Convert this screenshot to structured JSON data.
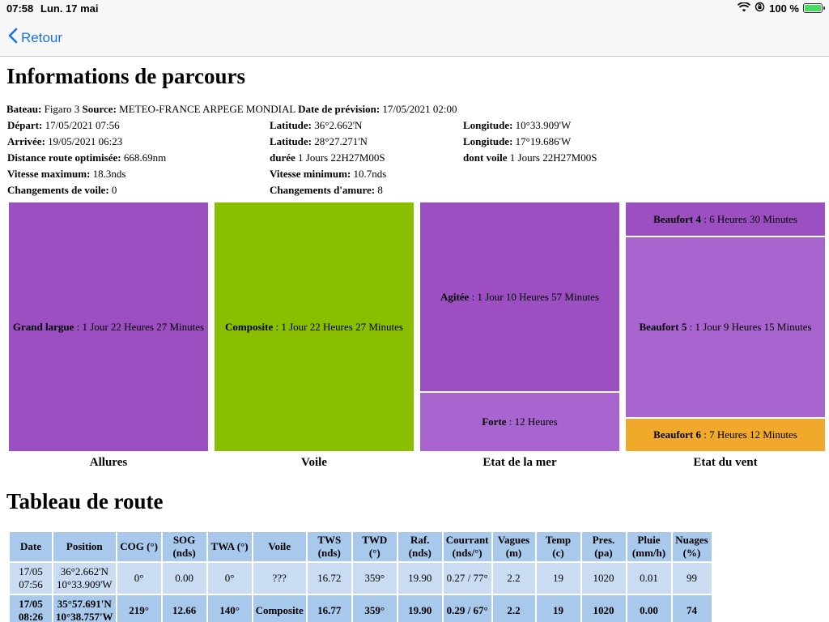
{
  "status": {
    "time": "07:58",
    "date": "Lun. 17 mai",
    "battery": "100 %",
    "battery_level": 1.0
  },
  "nav": {
    "back_label": "Retour"
  },
  "info": {
    "title": "Informations de parcours",
    "line1": {
      "bateau_label": "Bateau:",
      "bateau": "Figaro 3",
      "source_label": "Source:",
      "source": "METEO-FRANCE ARPEGE MONDIAL",
      "prevision_label": "Date de prévision:",
      "prevision": "17/05/2021 02:00"
    },
    "rows": [
      [
        {
          "label": "Départ:",
          "value": "17/05/2021 07:56"
        },
        {
          "label": "Latitude:",
          "value": "36°2.662'N"
        },
        {
          "label": "Longitude:",
          "value": "10°33.909'W"
        }
      ],
      [
        {
          "label": "Arrivée:",
          "value": "19/05/2021 06:23"
        },
        {
          "label": "Latitude:",
          "value": "28°27.271'N"
        },
        {
          "label": "Longitude:",
          "value": "17°19.686'W"
        }
      ],
      [
        {
          "label": "Distance route optimisée:",
          "value": "668.69nm"
        },
        {
          "label": "durée",
          "value": "1 Jours 22H27M00S"
        },
        {
          "label": "dont voile",
          "value": "1 Jours 22H27M00S"
        }
      ],
      [
        {
          "label": "Vitesse maximum:",
          "value": "18.3nds"
        },
        {
          "label": "Vitesse minimum:",
          "value": "10.7nds"
        }
      ],
      [
        {
          "label": "Changements de voile:",
          "value": "0"
        },
        {
          "label": "Changements d'amure:",
          "value": "8"
        }
      ]
    ]
  },
  "treemaps": [
    {
      "caption": "Allures",
      "cells": [
        {
          "label": "Grand largue",
          "value": "1 Jour 22 Heures 27 Minutes",
          "color": "#9b4fc1"
        }
      ]
    },
    {
      "caption": "Voile",
      "cells": [
        {
          "label": "Composite",
          "value": "1 Jour 22 Heures 27 Minutes",
          "color": "#8abf00"
        }
      ]
    },
    {
      "caption": "Etat de la mer",
      "cells": [
        {
          "label": "Agitée",
          "value": "1 Jour 10 Heures 57 Minutes",
          "color": "#9b4fc1"
        },
        {
          "label": "Forte",
          "value": "12 Heures",
          "color": "#a865d0"
        }
      ]
    },
    {
      "caption": "Etat du vent",
      "cells": [
        {
          "label": "Beaufort 4",
          "value": "6 Heures 30 Minutes",
          "color": "#9b4fc1"
        },
        {
          "label": "Beaufort 5",
          "value": "1 Jour 9 Heures 15 Minutes",
          "color": "#a865d0"
        },
        {
          "label": "Beaufort 6",
          "value": "7 Heures 12 Minutes",
          "color": "#f0a92a"
        }
      ]
    }
  ],
  "route": {
    "title": "Tableau de route",
    "headers": [
      "Date",
      "Position",
      "COG (°)",
      "SOG (nds)",
      "TWA (°)",
      "Voile",
      "TWS (nds)",
      "TWD (°)",
      "Raf. (nds)",
      "Courrant (nds/°)",
      "Vagues (m)",
      "Temp (c)",
      "Pres. (pa)",
      "Pluie (mm/h)",
      "Nuages (%)"
    ],
    "rows": [
      [
        "17/05 07:56",
        "36°2.662'N 10°33.909'W",
        "0°",
        "0.00",
        "0°",
        "???",
        "16.72",
        "359°",
        "19.90",
        "0.27 / 77°",
        "2.2",
        "19",
        "1020",
        "0.01",
        "99"
      ],
      [
        "17/05 08:26",
        "35°57.691'N 10°38.757'W",
        "219°",
        "12.66",
        "140°",
        "Composite",
        "16.77",
        "359°",
        "19.90",
        "0.29 / 67°",
        "2.2",
        "19",
        "1020",
        "0.00",
        "74"
      ]
    ]
  }
}
